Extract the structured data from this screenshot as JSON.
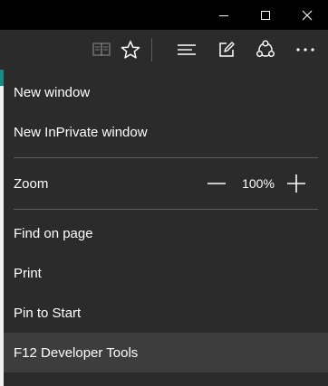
{
  "titlebar": {
    "icons": [
      "minimize-icon",
      "maximize-icon",
      "close-icon"
    ]
  },
  "toolbar": {
    "icons": [
      "reading-view-icon",
      "favorites-star-icon",
      "hub-icon",
      "web-note-icon",
      "share-icon",
      "more-actions-icon"
    ]
  },
  "menu": {
    "new_window": "New window",
    "new_inprivate": "New InPrivate window",
    "zoom_label": "Zoom",
    "zoom_value": "100%",
    "find_on_page": "Find on page",
    "print": "Print",
    "pin_to_start": "Pin to Start",
    "dev_tools": "F12 Developer Tools"
  },
  "colors": {
    "titlebar_bg": "#000000",
    "toolbar_bg": "#2b2b2b",
    "menu_bg": "#2b2b2b",
    "highlight_bg": "#3d3d3d",
    "divider": "#5c5c5c",
    "text": "#ffffff",
    "page_accent": "#1a8a86"
  }
}
